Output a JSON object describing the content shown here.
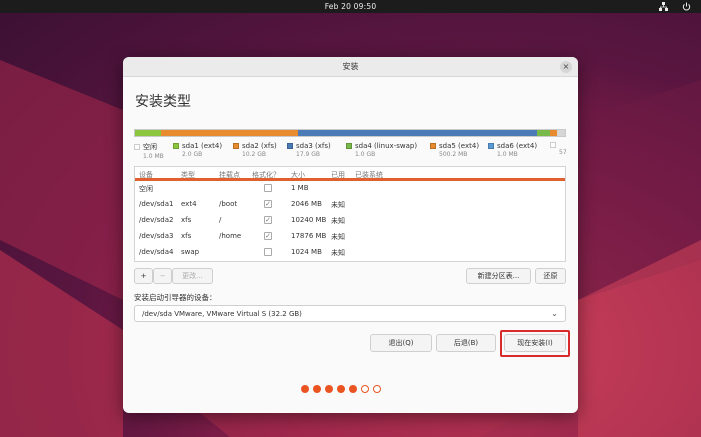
{
  "topbar": {
    "clock": "Feb 20  09:50"
  },
  "colors": {
    "accent": "#e95420",
    "free": "#ffffff",
    "sda1": "#8cc63f",
    "sda2": "#e88b2e",
    "sda3": "#4a7bb7",
    "sda4": "#78b94a",
    "sda5": "#e88b2e",
    "sda6": "#5b9bd5"
  },
  "window": {
    "title": "安装",
    "heading": "安装类型"
  },
  "partition_bar": [
    {
      "name": "sda1",
      "fraction": 0.061,
      "color": "#8cc63f"
    },
    {
      "name": "sda2",
      "fraction": 0.318,
      "color": "#e88b2e"
    },
    {
      "name": "sda3",
      "fraction": 0.555,
      "color": "#4a7bb7"
    },
    {
      "name": "sda4",
      "fraction": 0.031,
      "color": "#78b94a"
    },
    {
      "name": "sda5",
      "fraction": 0.016,
      "color": "#e88b2e"
    },
    {
      "name": "sda6",
      "fraction": 0.019,
      "color": "#d6d6d6"
    }
  ],
  "legend": [
    {
      "label": "空闲",
      "size": "1.0 MB",
      "color": "#ffffff"
    },
    {
      "label": "sda1 (ext4)",
      "size": "2.0 GB",
      "color": "#8cc63f"
    },
    {
      "label": "sda2 (xfs)",
      "size": "10.2 GB",
      "color": "#e88b2e"
    },
    {
      "label": "sda3 (xfs)",
      "size": "17.9 GB",
      "color": "#4a7bb7"
    },
    {
      "label": "sda4 (linux-swap)",
      "size": "1.0 GB",
      "color": "#78b94a"
    },
    {
      "label": "sda5 (ext4)",
      "size": "500.2 MB",
      "color": "#e88b2e"
    },
    {
      "label": "sda6 (ext4)",
      "size": "1.0 MB",
      "color": "#5b9bd5"
    },
    {
      "label": "",
      "size": "57",
      "color": "#ffffff"
    }
  ],
  "table": {
    "headers": [
      "设备",
      "类型",
      "挂载点",
      "格式化？",
      "大小",
      "已用",
      "已装系统"
    ],
    "rows": [
      {
        "device": "空闲",
        "type": "",
        "mount": "",
        "format": false,
        "size": "1 MB",
        "used": ""
      },
      {
        "device": "/dev/sda1",
        "type": "ext4",
        "mount": "/boot",
        "format": true,
        "size": "2046 MB",
        "used": "未知"
      },
      {
        "device": "/dev/sda2",
        "type": "xfs",
        "mount": "/",
        "format": true,
        "size": "10240 MB",
        "used": "未知"
      },
      {
        "device": "/dev/sda3",
        "type": "xfs",
        "mount": "/home",
        "format": true,
        "size": "17876 MB",
        "used": "未知"
      },
      {
        "device": "/dev/sda4",
        "type": "swap",
        "mount": "",
        "format": false,
        "size": "1024 MB",
        "used": "未知"
      }
    ]
  },
  "table_buttons": {
    "add": "+",
    "remove": "−",
    "change": "更改...",
    "new_table": "新建分区表...",
    "revert": "还原"
  },
  "boot": {
    "label": "安装启动引导器的设备：",
    "selected": "/dev/sda   VMware, VMware Virtual S (32.2 GB)"
  },
  "actions": {
    "quit": "退出(Q)",
    "back": "后退(B)",
    "install": "现在安装(I)"
  },
  "progress": {
    "total": 7,
    "completed": 5
  }
}
